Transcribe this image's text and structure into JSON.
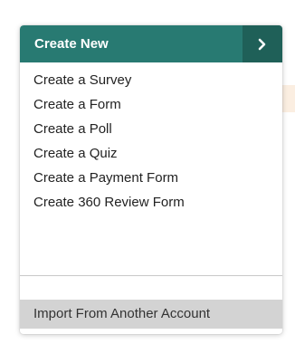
{
  "dropdown": {
    "header_label": "Create New",
    "chevron_icon": "chevron-right-icon",
    "header_color": "#287a72",
    "chevron_bg_color": "#1f6058",
    "items": [
      {
        "label": "Create a Survey"
      },
      {
        "label": "Create a Form"
      },
      {
        "label": "Create a Poll"
      },
      {
        "label": "Create a Quiz"
      },
      {
        "label": "Create a Payment Form"
      },
      {
        "label": "Create 360 Review Form"
      }
    ],
    "import_label": "Import From Another Account",
    "import_highlight_color": "#d3d3d3"
  }
}
